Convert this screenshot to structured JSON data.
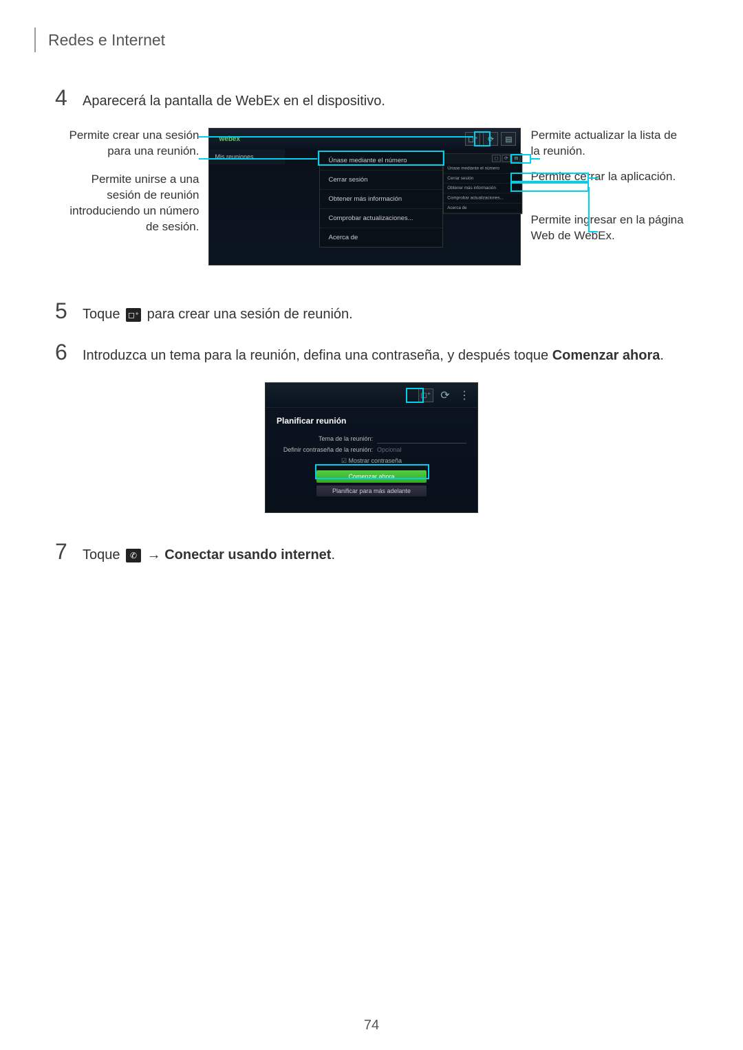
{
  "header": "Redes e Internet",
  "step4": {
    "num": "4",
    "text": "Aparecerá la pantalla de WebEx en el dispositivo."
  },
  "annotL1": "Permite crear una sesión para una reunión.",
  "annotL2": "Permite unirse a una sesión de reunión introduciendo un número de sesión.",
  "annotR1": "Permite actualizar la lista de la reunión.",
  "annotR2": "Permite cerrar la aplicación.",
  "annotR3": "Permite ingresar en la página Web de WebEx.",
  "mock": {
    "logo": "webex",
    "sidebar": "Mis reuniones",
    "menu1": "Únase mediante el número",
    "menu2": "Cerrar sesión",
    "menu3": "Obtener más información",
    "menu4": "Comprobar actualizaciones...",
    "menu5": "Acerca de"
  },
  "step5": {
    "num": "5",
    "pre": "Toque ",
    "post": " para crear una sesión de reunión."
  },
  "step6": {
    "num": "6",
    "text_a": "Introduzca un tema para la reunión, defina una contraseña, y después toque ",
    "text_b": "Comenzar ahora",
    "text_c": "."
  },
  "mock2": {
    "title": "Planificar reunión",
    "labelTema": "Tema de la reunión:",
    "labelPwd": "Definir contraseña de la reunión:",
    "opcional": "Opcional",
    "show": "Mostrar contraseña",
    "start": "Comenzar ahora",
    "plan": "Planificar para más adelante"
  },
  "step7": {
    "num": "7",
    "pre": "Toque ",
    "arrow": " → ",
    "bold": "Conectar usando internet",
    "end": "."
  },
  "pagenum": "74"
}
